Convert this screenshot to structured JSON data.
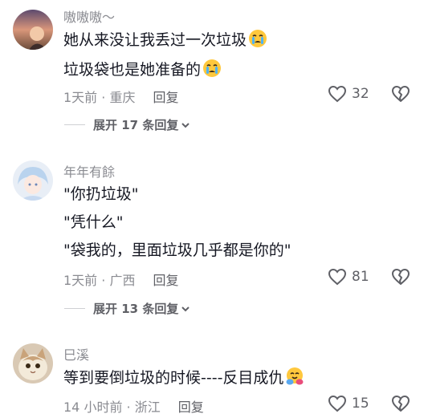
{
  "comments": [
    {
      "username": "嗷嗷嗷～",
      "lines": [
        "她从来没让我丢过一次垃圾",
        "垃圾袋也是她准备的"
      ],
      "time_location": "1天前 · 重庆",
      "reply_label": "回复",
      "likes": "32",
      "expand_label": "展开 17 条回复",
      "emoji": "crying-face"
    },
    {
      "username": "年年有餘",
      "lines": [
        "\"你扔垃圾\"",
        "\"凭什么\"",
        "\"袋我的，里面垃圾几乎都是你的\""
      ],
      "time_location": "1天前 · 广西",
      "reply_label": "回复",
      "likes": "81",
      "expand_label": "展开 13 条回复"
    },
    {
      "username": "巳溪",
      "lines": [
        "等到要倒垃圾的时候----反目成仇"
      ],
      "time_location": "14 小时前 · 浙江",
      "reply_label": "回复",
      "likes": "15",
      "emoji": "hugging-face"
    }
  ],
  "colors": {
    "text": "#161823",
    "secondary": "#8a8b91",
    "meta_dark": "#5f6066"
  }
}
